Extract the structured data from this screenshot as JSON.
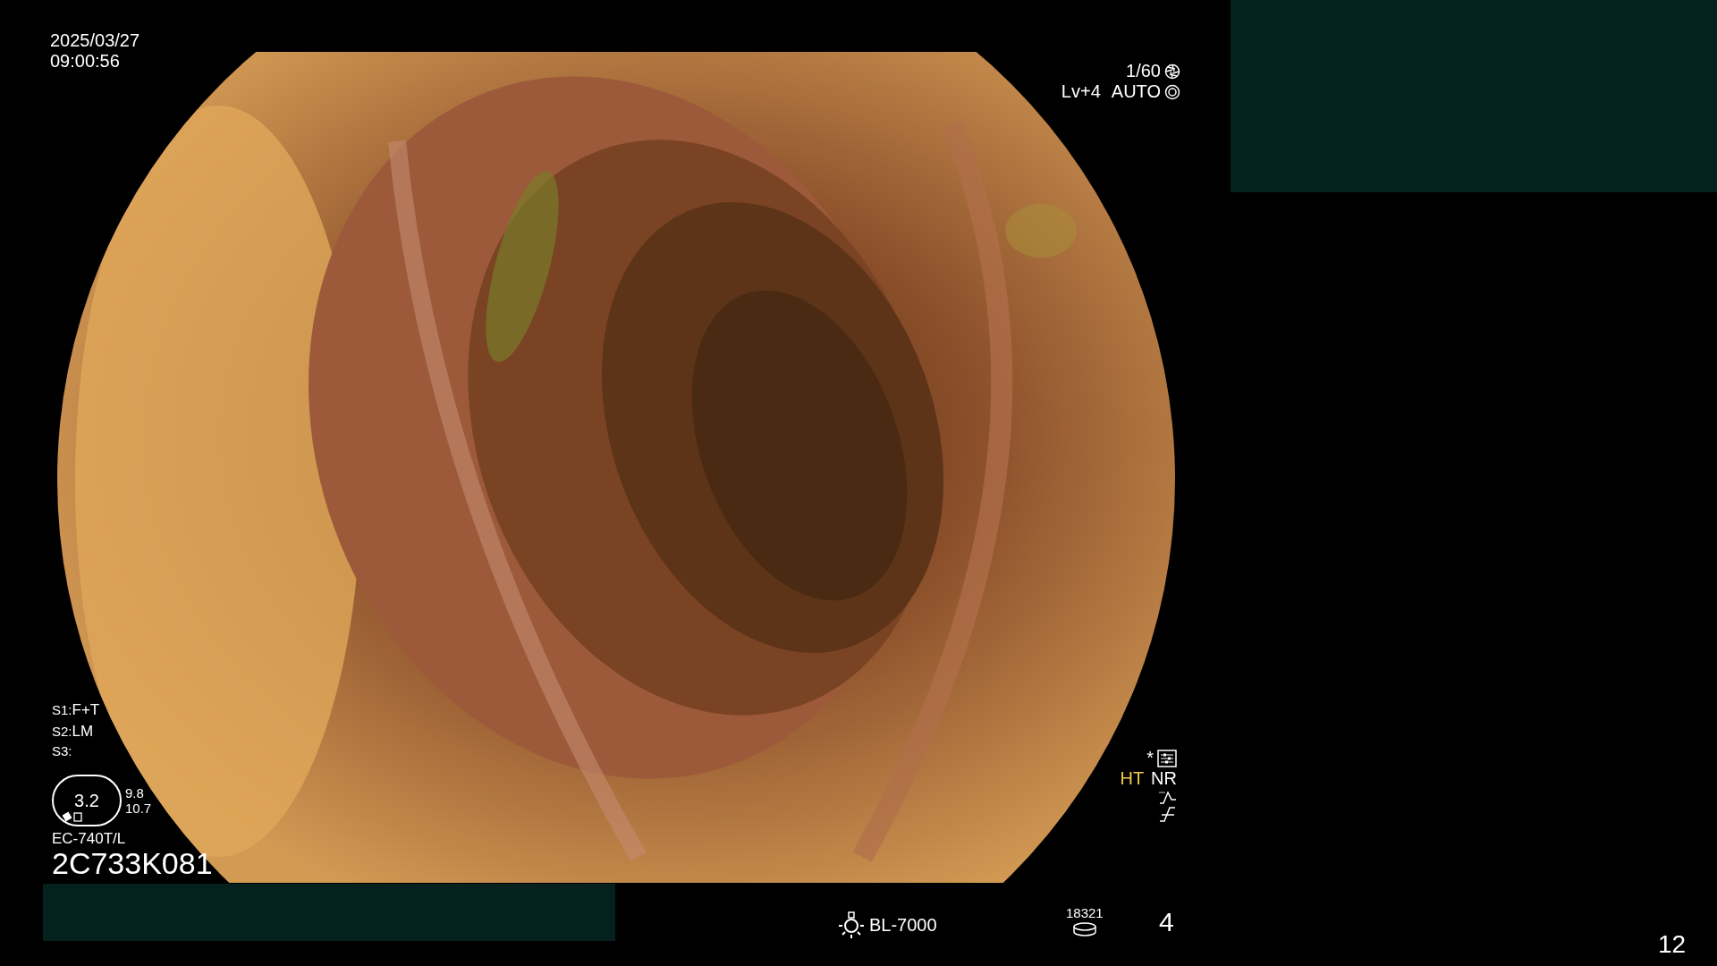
{
  "datetime": {
    "date": "2025/03/27",
    "time": "09:00:56"
  },
  "exposure": {
    "shutter": "1/60",
    "level": "Lv+4",
    "mode": "AUTO"
  },
  "scope_settings": [
    {
      "label": "S1:",
      "value": "F+T"
    },
    {
      "label": "S2:",
      "value": "LM"
    },
    {
      "label": "S3:"
    }
  ],
  "zoom_gauge": {
    "value": "3.2",
    "readings": [
      "9.8",
      "10.7"
    ]
  },
  "scope": {
    "model": "EC-740T/L",
    "serial": "2C733K081"
  },
  "enhancement": {
    "mark": "*",
    "items": [
      {
        "label": "HT",
        "highlighted": true
      },
      {
        "label": "NR",
        "highlighted": false
      }
    ]
  },
  "light_source": "BL-7000",
  "counter": "18321",
  "page": "4",
  "frame_number": "12"
}
